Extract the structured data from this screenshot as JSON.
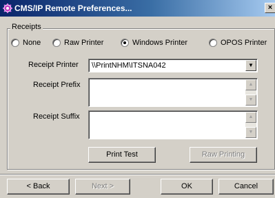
{
  "window": {
    "title": "CMS/IP Remote Preferences...",
    "close_label": "×",
    "icon": "app-gear-icon",
    "accent": "#0a246a"
  },
  "receipts": {
    "group_label": "Receipts",
    "printer_types": [
      {
        "label": "None",
        "selected": false
      },
      {
        "label": "Raw Printer",
        "selected": false
      },
      {
        "label": "Windows Printer",
        "selected": true
      },
      {
        "label": "OPOS Printer",
        "selected": false
      }
    ],
    "printer_label": "Receipt Printer",
    "printer_value": "\\\\PrintNHM\\ITSNA042",
    "prefix_label": "Receipt Prefix",
    "prefix_value": "",
    "suffix_label": "Receipt Suffix",
    "suffix_value": "",
    "print_test_label": "Print Test",
    "raw_printing_label": "Raw Printing"
  },
  "footer": {
    "back_label": "< Back",
    "next_label": "Next >",
    "ok_label": "OK",
    "cancel_label": "Cancel"
  },
  "glyphs": {
    "dropdown": "▼",
    "scroll_up": "▲",
    "scroll_down": "▼"
  }
}
